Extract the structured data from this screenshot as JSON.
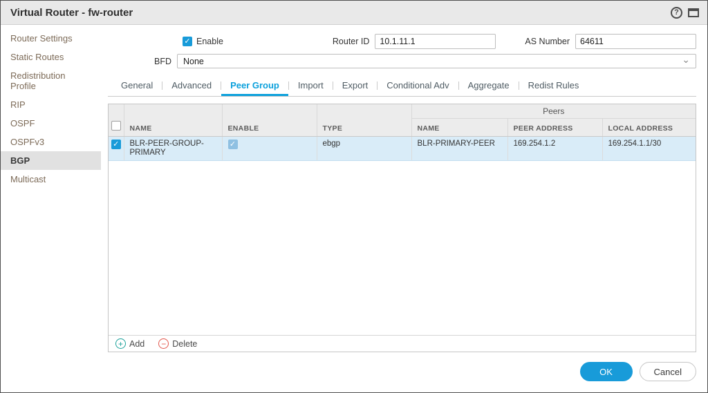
{
  "window": {
    "title": "Virtual Router - fw-router"
  },
  "sidebar": {
    "items": [
      {
        "label": "Router Settings",
        "active": false
      },
      {
        "label": "Static Routes",
        "active": false
      },
      {
        "label": "Redistribution Profile",
        "active": false
      },
      {
        "label": "RIP",
        "active": false
      },
      {
        "label": "OSPF",
        "active": false
      },
      {
        "label": "OSPFv3",
        "active": false
      },
      {
        "label": "BGP",
        "active": true
      },
      {
        "label": "Multicast",
        "active": false
      }
    ]
  },
  "form": {
    "enable_label": "Enable",
    "enable_checked": true,
    "router_id_label": "Router ID",
    "router_id_value": "10.1.11.1",
    "as_number_label": "AS Number",
    "as_number_value": "64611",
    "bfd_label": "BFD",
    "bfd_value": "None"
  },
  "tabs": [
    {
      "label": "General",
      "active": false
    },
    {
      "label": "Advanced",
      "active": false
    },
    {
      "label": "Peer Group",
      "active": true
    },
    {
      "label": "Import",
      "active": false
    },
    {
      "label": "Export",
      "active": false
    },
    {
      "label": "Conditional Adv",
      "active": false
    },
    {
      "label": "Aggregate",
      "active": false
    },
    {
      "label": "Redist Rules",
      "active": false
    }
  ],
  "table": {
    "group_header": "Peers",
    "columns": {
      "name": "NAME",
      "enable": "ENABLE",
      "type": "TYPE"
    },
    "peers_columns": {
      "name": "NAME",
      "peer_address": "PEER ADDRESS",
      "local_address": "LOCAL ADDRESS"
    },
    "rows": [
      {
        "selected": true,
        "checked": true,
        "name": "BLR-PEER-GROUP-PRIMARY",
        "enable": true,
        "type": "ebgp",
        "peer_name": "BLR-PRIMARY-PEER",
        "peer_address": "169.254.1.2",
        "local_address": "169.254.1.1/30"
      }
    ],
    "footer": {
      "add_label": "Add",
      "delete_label": "Delete"
    }
  },
  "actions": {
    "ok_label": "OK",
    "cancel_label": "Cancel"
  },
  "icons": {
    "check": "✓",
    "plus": "+",
    "minus": "−",
    "chevron_down": "⌄",
    "help": "?"
  },
  "colors": {
    "accent_blue": "#189bd9",
    "selected_row": "#d9ecf8",
    "add_green": "#1ba19a",
    "delete_red": "#e2574c"
  }
}
